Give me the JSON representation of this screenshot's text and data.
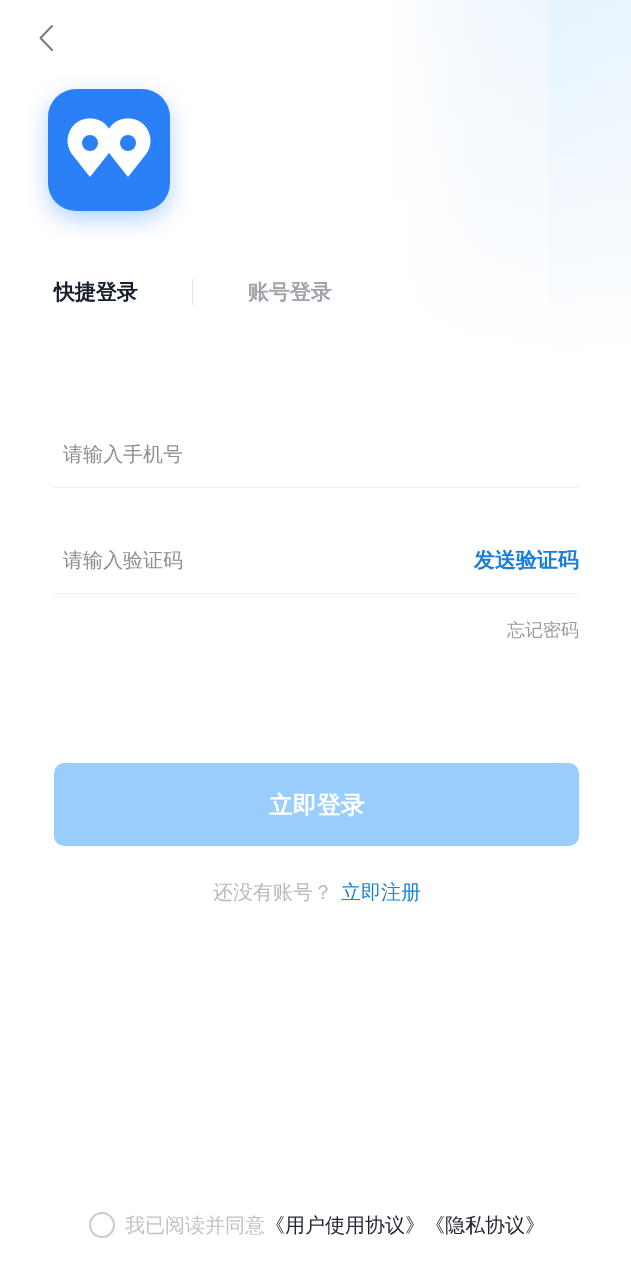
{
  "tabs": [
    {
      "label": "快捷登录",
      "selected": true
    },
    {
      "label": "账号登录",
      "selected": false
    }
  ],
  "fields": [
    {
      "placeholder": "请输入手机号"
    },
    {
      "placeholder": "请输入验证码",
      "action": "发送验证码"
    }
  ],
  "forgot_password": "忘记密码",
  "login_button": {
    "label": "立即登录",
    "disabled": true
  },
  "register_prompt": {
    "text": "还没有账号？",
    "link": "立即注册"
  },
  "agreement": {
    "checked": false,
    "text": "我已阅读并同意",
    "links": [
      "《用户使用协议》",
      "《隐私协议》"
    ]
  }
}
